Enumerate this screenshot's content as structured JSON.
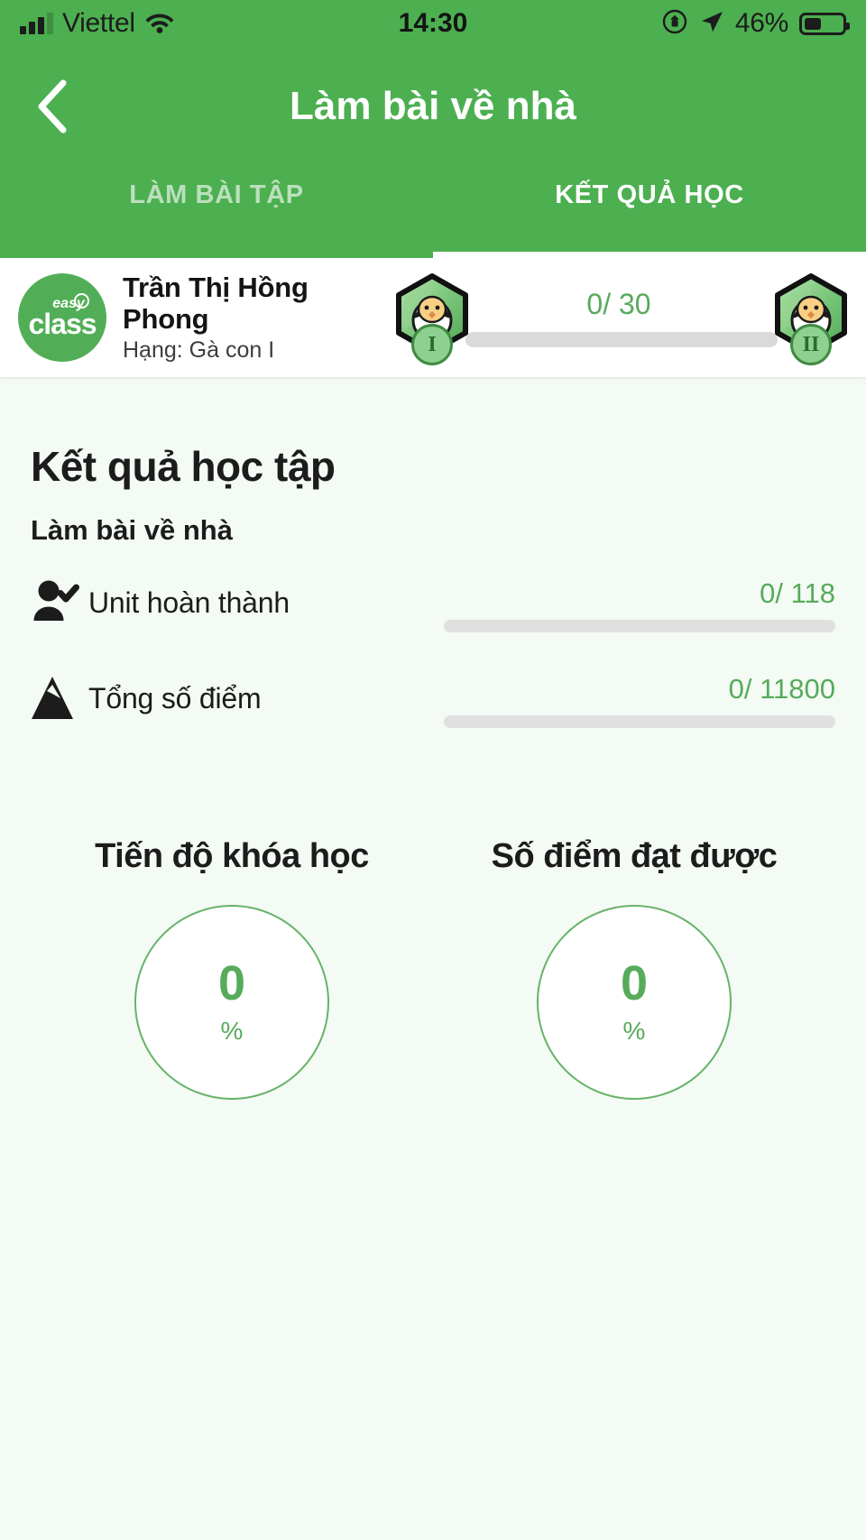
{
  "status_bar": {
    "carrier": "Viettel",
    "time": "14:30",
    "battery_percent": "46%",
    "wifi_icon": "wifi-icon",
    "signal_icon": "signal-bars-icon",
    "rotation_lock_icon": "rotation-lock-icon",
    "location_icon": "location-arrow-icon",
    "battery_icon": "battery-icon"
  },
  "header": {
    "back_icon": "back-chevron-icon",
    "title": "Làm bài về nhà",
    "tabs": [
      {
        "label": "LÀM BÀI TẬP",
        "active": false
      },
      {
        "label": "KẾT QUẢ HỌC",
        "active": true
      }
    ]
  },
  "profile": {
    "avatar_logo_top": "easy",
    "avatar_logo_main": "class",
    "name": "Trần Thị Hồng Phong",
    "rank": "Hạng: Gà con I",
    "progress_value": "0/ 30",
    "progress_percent": 0,
    "current_badge_level": "I",
    "next_badge_level": "II",
    "badge_icon": "chick-hatching-hexagon-badge"
  },
  "main": {
    "section_title": "Kết quả học tập",
    "section_subtitle": "Làm bài về nhà",
    "stats": [
      {
        "icon": "person-check-icon",
        "label": "Unit hoàn thành",
        "value": "0/ 118",
        "percent": 0
      },
      {
        "icon": "mountain-icon",
        "label": "Tổng số điểm",
        "value": "0/ 11800",
        "percent": 0
      }
    ],
    "gauges": [
      {
        "title": "Tiến độ khóa học",
        "value": "0",
        "unit": "%"
      },
      {
        "title": "Số điểm đạt được",
        "value": "0",
        "unit": "%"
      }
    ]
  },
  "colors": {
    "brand_green": "#4caf50",
    "text_green": "#57ab5b",
    "page_background": "#f4faf4",
    "track_gray": "#e0e0e0"
  }
}
